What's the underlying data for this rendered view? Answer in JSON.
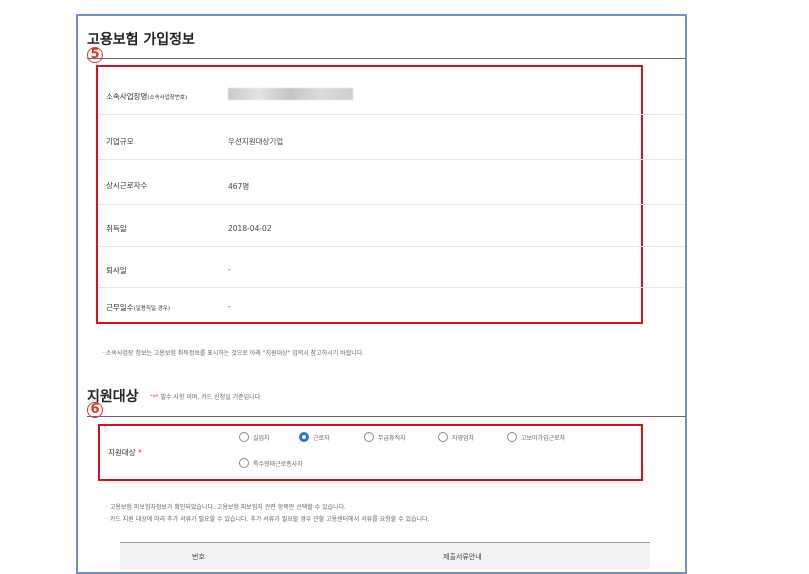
{
  "section_insurance": {
    "title": "고용보험 가입정보",
    "marker": "5",
    "rows": [
      {
        "label": "소속사업장명",
        "sub": "(소속사업장번호)",
        "value": ""
      },
      {
        "label": "기업규모",
        "value": "우선지원대상기업"
      },
      {
        "label": "상시근로자수",
        "value": "467명"
      },
      {
        "label": "취득일",
        "value": "2018-04-02"
      },
      {
        "label": "퇴사일",
        "value": "-"
      },
      {
        "label": "근무일수",
        "sub": "(일용직일 경우)",
        "value": "-"
      }
    ],
    "note": "· 소속사업장 정보는 고용보험 취득정보를 표시하는 것으로 아래 \"지원대상\" 입력시 참고하시기 바랍니다."
  },
  "section_support": {
    "title": "지원대상",
    "required_star": "\"*\"",
    "hint": "필수 사항 이며, 카드 신청일 기준입니다.",
    "marker": "6",
    "field_label": "지원대상",
    "field_star": "*",
    "options": [
      {
        "label": "실업자",
        "selected": false
      },
      {
        "label": "근로자",
        "selected": true
      },
      {
        "label": "무급휴직자",
        "selected": false
      },
      {
        "label": "자영업자",
        "selected": false
      },
      {
        "label": "고보미가입근로자",
        "selected": false
      },
      {
        "label": "특수형태근로종사자",
        "selected": false
      }
    ],
    "notes": [
      "· 고용보험 피보험자정보가 확인되었습니다. 고용보험 피보험자 관련 항목만 선택할 수 있습니다.",
      "· 카드 지원 대상에 따라 추가 서류가 필요할 수 있습니다. 추가 서류가 필요할 경우 관할 고용센터에서 서류를 요청할 수 있습니다."
    ]
  },
  "docs_table": {
    "headers": [
      "번호",
      "제출서류안내"
    ]
  },
  "colors": {
    "red_box": "#d7101e",
    "frame": "#6f8fcf",
    "radio_selected": "#2c6fd9"
  }
}
